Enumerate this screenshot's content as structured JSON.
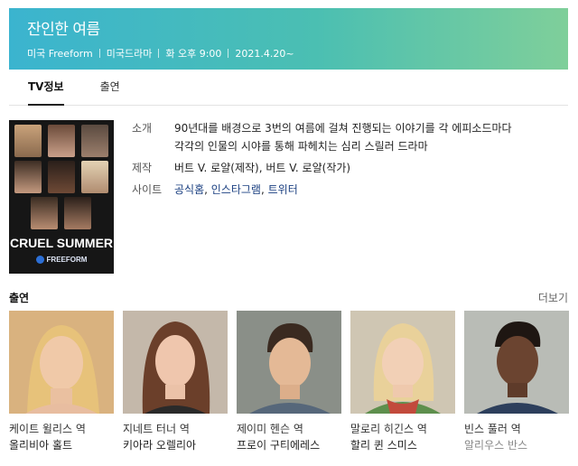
{
  "header": {
    "title": "잔인한 여름",
    "meta": [
      "미국 Freeform",
      "미국드라마",
      "화 오후 9:00",
      "2021.4.20~"
    ],
    "gradient_start": "#3bb4cf",
    "gradient_end": "#7fcf9a"
  },
  "tabs": [
    {
      "label": "TV정보",
      "active": true
    },
    {
      "label": "출연",
      "active": false
    }
  ],
  "poster": {
    "title": "CRUEL SUMMER",
    "brand": "FREEFORM"
  },
  "info": {
    "synopsis_label": "소개",
    "synopsis_line1": "90년대를 배경으로 3번의 여름에 걸쳐 진행되는 이야기를 각 에피소드마다",
    "synopsis_line2": "각각의 인물의 시야를 통해 파헤치는 심리 스릴러 드라마",
    "production_label": "제작",
    "production_name1": "버트 V. 로얄",
    "production_role1": "(제작)",
    "production_sep": ", ",
    "production_name2": "버트 V. 로얄",
    "production_role2": "(작가)",
    "site_label": "사이트",
    "sites": [
      "공식홈",
      "인스타그램",
      "트위터"
    ],
    "site_sep": ", "
  },
  "cast": {
    "title": "출연",
    "more": "더보기",
    "members": [
      {
        "role": "케이트 윌리스 역",
        "actor": "올리비아 홀트"
      },
      {
        "role": "지네트 터너 역",
        "actor": "키아라 오렐리아"
      },
      {
        "role": "제이미 헨슨 역",
        "actor": "프로이 구티에레스"
      },
      {
        "role": "말로리 히긴스 역",
        "actor": "할리 퀸 스미스"
      },
      {
        "role": "빈스 풀러 역",
        "actor": "알리우스 반스"
      }
    ]
  }
}
